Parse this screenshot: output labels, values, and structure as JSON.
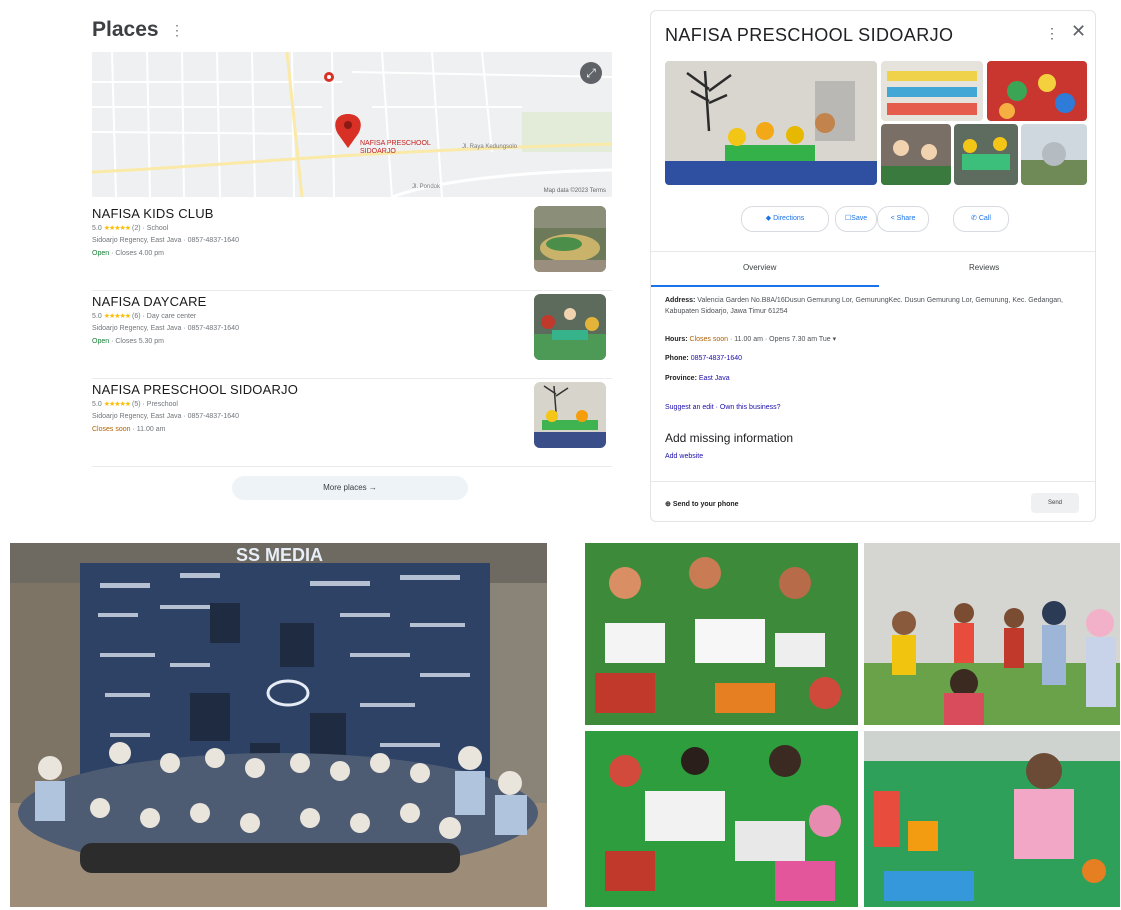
{
  "places": {
    "title": "Places",
    "title_menu": "⋮",
    "map": {
      "pin_label_line1": "NAFISA PRESCHOOL",
      "pin_label_line2": "SIDOARJO",
      "street_labels": [
        "Jl. Raya Kedungsolo",
        "Jl. Pondok"
      ],
      "footer": "Map data ©2023   Terms"
    },
    "items": [
      {
        "name": "NAFISA KIDS CLUB",
        "rating": "5.0",
        "stars": "★★★★★",
        "reviews_type": "(2) · School",
        "address_phone": "Sidoarjo Regency, East Java · 0857-4837-1640",
        "status": "Open",
        "hours": "· Closes 4.00 pm"
      },
      {
        "name": "NAFISA DAYCARE",
        "rating": "5.0",
        "stars": "★★★★★",
        "reviews_type": "(6) · Day care center",
        "address_phone": "Sidoarjo Regency, East Java · 0857-4837-1640",
        "status": "Open",
        "hours": "· Closes 5.30 pm"
      },
      {
        "name": "NAFISA PRESCHOOL SIDOARJO",
        "rating": "5.0",
        "stars": "★★★★★",
        "reviews_type": "(5) · Preschool",
        "address_phone": "Sidoarjo Regency, East Java · 0857-4837-1640",
        "status": "Closes soon",
        "hours": "· 11.00 am"
      }
    ],
    "more_label": "More places  →"
  },
  "knowledge_panel": {
    "title": "NAFISA PRESCHOOL SIDOARJO",
    "menu_icon": "⋮",
    "close_icon": "✕",
    "actions": [
      {
        "icon": "◆",
        "label": "Directions"
      },
      {
        "icon": "☐",
        "label": "Save"
      },
      {
        "icon": "<",
        "label": "Share"
      },
      {
        "icon": "✆",
        "label": "Call"
      }
    ],
    "tabs": [
      "Overview",
      "Reviews"
    ],
    "address_label": "Address:",
    "address_value": "Valencia Garden No.B8A/16Dusun Gemurung Lor, GemurungKec. Dusun Gemurung Lor, Gemurung, Kec. Gedangan, Kabupaten Sidoarjo, Jawa Timur 61254",
    "hours_label": "Hours:",
    "hours_status": "Closes soon",
    "hours_detail": "· 11.00 am · Opens 7.30 am Tue ▾",
    "phone_label": "Phone:",
    "phone_value": "0857-4837-1640",
    "province_label": "Province:",
    "province_value": "East Java",
    "suggest_edit": "Suggest an edit · Own this business?",
    "add_missing": "Add missing information",
    "add_website": "Add website",
    "send_label": "Send to your phone",
    "send_button": "Send"
  },
  "banner_text": {
    "brand": "SS MEDIA"
  },
  "colors": {
    "link": "#1a0dab",
    "open": "#188038",
    "closing_soon": "#b06000",
    "star": "#fbbc04",
    "pin": "#d93025",
    "wall": "#2e4266"
  }
}
